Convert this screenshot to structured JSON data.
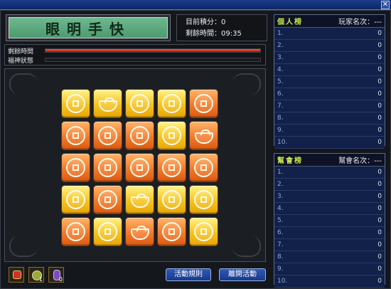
{
  "window": {
    "close_glyph": "✕"
  },
  "title": "眼明手快",
  "score": {
    "current_label": "目前積分：",
    "current_value": "0",
    "time_label": "剩餘時間：",
    "time_value": "09:35"
  },
  "bars": [
    {
      "label": "剩餘時間",
      "fill": 1.0
    },
    {
      "label": "福神狀態",
      "fill": 0.0
    }
  ],
  "board": [
    [
      "yellow-coin",
      "yellow-ingot",
      "yellow-coin",
      "yellow-coin",
      "orange-coin"
    ],
    [
      "orange-coin",
      "orange-coin",
      "orange-coin",
      "yellow-coin",
      "orange-ingot"
    ],
    [
      "orange-coin",
      "orange-coin",
      "orange-coin",
      "orange-coin",
      "orange-coin"
    ],
    [
      "yellow-coin",
      "orange-coin",
      "yellow-ingot",
      "yellow-coin",
      "yellow-coin"
    ],
    [
      "orange-coin",
      "yellow-coin",
      "orange-ingot",
      "orange-coin",
      "yellow-coin"
    ]
  ],
  "items": [
    {
      "icon": "red-lantern-icon",
      "count": ""
    },
    {
      "icon": "coin-bag-icon",
      "count": "1"
    },
    {
      "icon": "purple-potion-icon",
      "count": "0"
    }
  ],
  "buttons": {
    "rules": "活動規則",
    "leave": "離開活動"
  },
  "personal": {
    "title": "個人榜",
    "rank_label": "玩家名次：---",
    "rows": [
      "1.",
      "2.",
      "3.",
      "4.",
      "5.",
      "6.",
      "7.",
      "8.",
      "9.",
      "10."
    ],
    "values": [
      "0",
      "0",
      "0",
      "0",
      "0",
      "0",
      "0",
      "0",
      "0",
      "0"
    ]
  },
  "guild": {
    "title": "幫會榜",
    "rank_label": "幫會名次：---",
    "rows": [
      "1.",
      "2.",
      "3.",
      "4.",
      "5.",
      "6.",
      "7.",
      "8.",
      "9.",
      "10."
    ],
    "values": [
      "0",
      "0",
      "0",
      "0",
      "0",
      "0",
      "0",
      "0",
      "0",
      "0"
    ]
  }
}
